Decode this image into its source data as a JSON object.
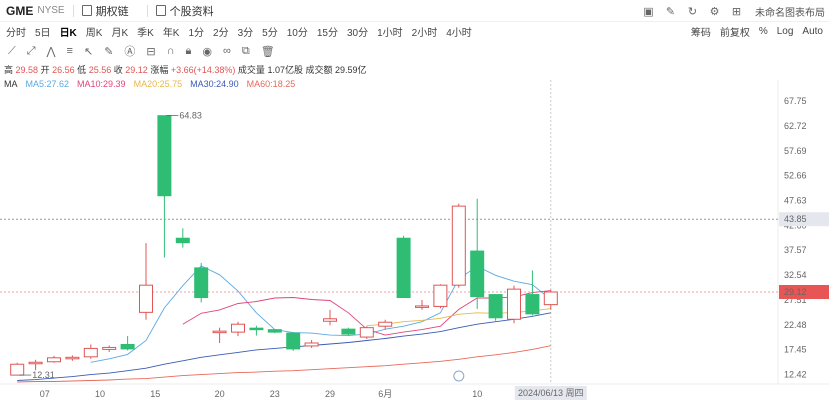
{
  "header": {
    "symbol": "GME",
    "exchange": "NYSE",
    "options_chain": "期权链",
    "stock_profile": "个股资料",
    "layout_name": "未命名图表布局"
  },
  "timeframes": [
    "分时",
    "5日",
    "日K",
    "周K",
    "月K",
    "季K",
    "年K",
    "1分",
    "2分",
    "3分",
    "5分",
    "10分",
    "15分",
    "30分",
    "1小时",
    "2小时",
    "4小时"
  ],
  "active_timeframe": "日K",
  "toolbar_right": {
    "indicator": "筹码",
    "adjust": "前复权",
    "percent": "%",
    "log": "Log",
    "auto": "Auto"
  },
  "info": {
    "high_label": "高",
    "high": "29.58",
    "open_label": "开",
    "open": "26.56",
    "low_label": "低",
    "low": "25.56",
    "close_label": "收",
    "close": "29.12",
    "change_label": "涨幅",
    "change": "+3.66(+14.38%)",
    "volume_label": "成交量",
    "volume": "1.07亿股",
    "turnover_label": "成交额",
    "turnover": "29.59亿"
  },
  "ma_legend": {
    "label": "MA",
    "items": [
      {
        "text": "MA5:27.62",
        "color": "#5aa9e6"
      },
      {
        "text": "MA10:29.39",
        "color": "#e0457b"
      },
      {
        "text": "MA20:25.75",
        "color": "#e8b84a"
      },
      {
        "text": "MA30:24.90",
        "color": "#3b5bb5"
      },
      {
        "text": "MA60:18.25",
        "color": "#e86a5a"
      }
    ]
  },
  "chart_data": {
    "type": "candlestick",
    "y_ticks": [
      "67.75",
      "62.72",
      "57.69",
      "52.66",
      "47.63",
      "42.60",
      "37.57",
      "32.54",
      "27.51",
      "22.48",
      "17.45",
      "12.42"
    ],
    "y_range": [
      10.5,
      70.0
    ],
    "x_ticks": [
      "07",
      "10",
      "15",
      "20",
      "23",
      "29",
      "6月",
      "10"
    ],
    "crosshair_price": "43.85",
    "last_price": "29.12",
    "crosshair_date": "2024/06/13 周四",
    "high_marker": "64.83",
    "low_marker": "12.31",
    "candles": [
      {
        "o": 12.3,
        "c": 14.5,
        "h": 14.8,
        "l": 12.31
      },
      {
        "o": 14.6,
        "c": 14.9,
        "h": 15.4,
        "l": 13.3
      },
      {
        "o": 15.0,
        "c": 15.8,
        "h": 16.2,
        "l": 14.8
      },
      {
        "o": 15.7,
        "c": 15.9,
        "h": 16.3,
        "l": 15.2
      },
      {
        "o": 16.0,
        "c": 17.7,
        "h": 18.5,
        "l": 15.6
      },
      {
        "o": 17.5,
        "c": 17.9,
        "h": 18.3,
        "l": 17.0
      },
      {
        "o": 18.5,
        "c": 17.6,
        "h": 20.2,
        "l": 17.3
      },
      {
        "o": 25.0,
        "c": 30.5,
        "h": 39.0,
        "l": 23.5
      },
      {
        "o": 64.8,
        "c": 48.6,
        "h": 64.83,
        "l": 36.1
      },
      {
        "o": 40.0,
        "c": 39.1,
        "h": 42.0,
        "l": 38.1
      },
      {
        "o": 34.0,
        "c": 28.0,
        "h": 35.0,
        "l": 27.0
      },
      {
        "o": 21.0,
        "c": 21.2,
        "h": 21.9,
        "l": 18.8
      },
      {
        "o": 21.0,
        "c": 22.6,
        "h": 23.1,
        "l": 20.2
      },
      {
        "o": 21.8,
        "c": 21.5,
        "h": 22.3,
        "l": 20.3
      },
      {
        "o": 21.5,
        "c": 21.0,
        "h": 21.6,
        "l": 20.8
      },
      {
        "o": 20.8,
        "c": 17.6,
        "h": 21.0,
        "l": 17.2
      },
      {
        "o": 18.2,
        "c": 18.8,
        "h": 19.4,
        "l": 17.8
      },
      {
        "o": 23.2,
        "c": 23.7,
        "h": 25.5,
        "l": 22.4
      },
      {
        "o": 21.6,
        "c": 20.6,
        "h": 21.9,
        "l": 20.3
      },
      {
        "o": 20.0,
        "c": 21.9,
        "h": 22.2,
        "l": 19.6
      },
      {
        "o": 22.2,
        "c": 23.0,
        "h": 23.5,
        "l": 21.5
      },
      {
        "o": 40.0,
        "c": 28.0,
        "h": 40.5,
        "l": 27.9
      },
      {
        "o": 26.0,
        "c": 26.3,
        "h": 27.5,
        "l": 25.5
      },
      {
        "o": 26.2,
        "c": 30.5,
        "h": 30.7,
        "l": 25.8
      },
      {
        "o": 30.5,
        "c": 46.5,
        "h": 47.0,
        "l": 30.0
      },
      {
        "o": 37.4,
        "c": 28.2,
        "h": 48.0,
        "l": 25.7
      },
      {
        "o": 28.6,
        "c": 23.9,
        "h": 28.6,
        "l": 23.3
      },
      {
        "o": 23.6,
        "c": 29.7,
        "h": 30.4,
        "l": 22.8
      },
      {
        "o": 28.6,
        "c": 24.7,
        "h": 33.5,
        "l": 24.4
      },
      {
        "o": 26.56,
        "c": 29.12,
        "h": 29.58,
        "l": 25.56
      }
    ],
    "ma_series": [
      {
        "name": "MA5",
        "color": "#5aa9e6",
        "values": [
          null,
          null,
          null,
          null,
          14.9,
          15.6,
          16.5,
          19.3,
          25.9,
          30.4,
          34.4,
          32.6,
          29.3,
          24.9,
          21.5,
          20.9,
          20.8,
          20.4,
          20.3,
          20.6,
          21.6,
          22.2,
          23.1,
          24.9,
          31.8,
          34.3,
          32.5,
          31.3,
          30.6,
          27.6
        ]
      },
      {
        "name": "MA10",
        "color": "#e0457b",
        "values": [
          null,
          null,
          null,
          null,
          null,
          null,
          null,
          null,
          null,
          22.6,
          24.8,
          25.5,
          26.8,
          27.2,
          27.9,
          28.0,
          27.6,
          27.4,
          24.9,
          21.6,
          20.4,
          21.0,
          21.5,
          22.2,
          25.6,
          27.9,
          27.9,
          28.1,
          29.0,
          29.4
        ]
      },
      {
        "name": "MA20",
        "color": "#e8b84a",
        "values": [
          null,
          null,
          null,
          null,
          null,
          null,
          null,
          null,
          null,
          null,
          null,
          null,
          null,
          null,
          null,
          null,
          null,
          null,
          null,
          22.3,
          22.6,
          23.1,
          23.4,
          23.8,
          24.6,
          24.9,
          24.8,
          25.0,
          25.3,
          25.75
        ]
      },
      {
        "name": "MA30",
        "color": "#3b5bb5",
        "values": [
          11.2,
          11.4,
          11.7,
          12.0,
          12.4,
          12.7,
          13.2,
          13.7,
          14.5,
          15.2,
          15.9,
          16.4,
          16.9,
          17.4,
          17.7,
          18.0,
          18.3,
          18.6,
          18.9,
          19.3,
          19.7,
          20.2,
          20.6,
          21.1,
          21.9,
          22.6,
          23.1,
          23.6,
          24.2,
          24.9
        ]
      },
      {
        "name": "MA60",
        "color": "#e86a5a",
        "values": [
          10.9,
          11.0,
          11.0,
          11.1,
          11.2,
          11.3,
          11.5,
          11.6,
          11.9,
          12.2,
          12.4,
          12.6,
          12.8,
          12.9,
          13.1,
          13.2,
          13.4,
          13.6,
          13.8,
          14.0,
          14.2,
          14.5,
          14.8,
          15.1,
          15.5,
          16.0,
          16.4,
          16.9,
          17.5,
          18.25
        ]
      }
    ]
  }
}
